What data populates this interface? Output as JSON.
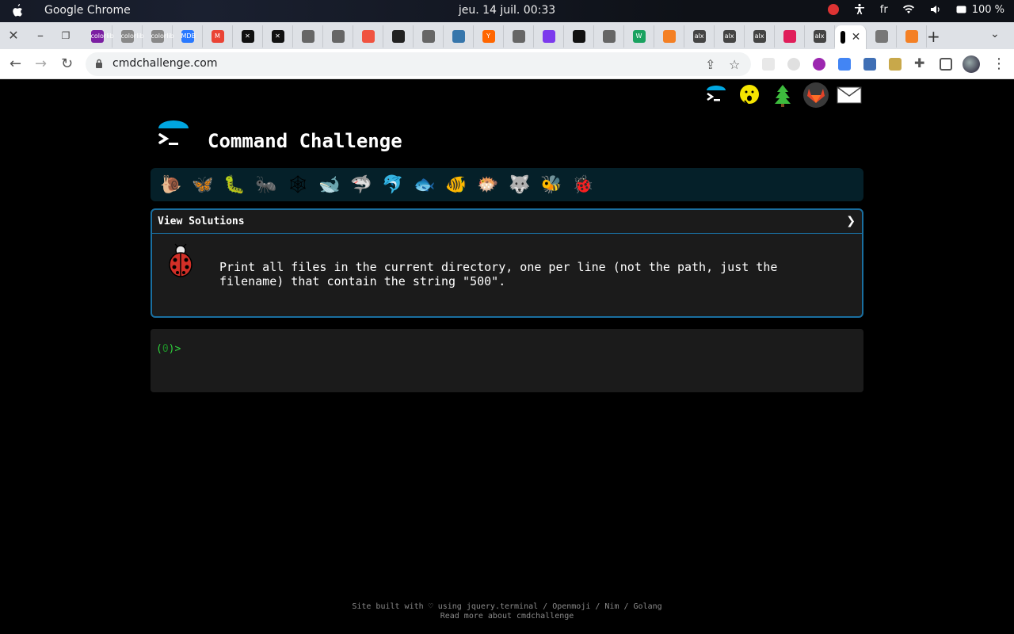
{
  "os": {
    "app_name": "Google Chrome",
    "clock": "jeu. 14 juil.  00:33",
    "lang": "fr",
    "battery": "100 %"
  },
  "browser": {
    "url": "cmdchallenge.com",
    "tabs": [
      {
        "icon": "colorlib-icon",
        "color": "#7b1fa2",
        "text": "colorlib"
      },
      {
        "icon": "colorlib-icon",
        "color": "#888888",
        "text": "colorlib"
      },
      {
        "icon": "colorlib-icon",
        "color": "#888888",
        "text": "colorlib"
      },
      {
        "icon": "mdb-icon",
        "color": "#2979ff",
        "text": "MDB"
      },
      {
        "icon": "gmail-icon",
        "color": "#ea4335",
        "text": "M"
      },
      {
        "icon": "x-circle-icon",
        "color": "#111111",
        "text": "✕"
      },
      {
        "icon": "x-circle-icon",
        "color": "#111111",
        "text": "✕"
      },
      {
        "icon": "globe-icon",
        "color": "#666666",
        "text": ""
      },
      {
        "icon": "globe-icon",
        "color": "#666666",
        "text": ""
      },
      {
        "icon": "laravel-icon",
        "color": "#f05340",
        "text": ""
      },
      {
        "icon": "badge-icon",
        "color": "#222222",
        "text": ""
      },
      {
        "icon": "globe-icon",
        "color": "#666666",
        "text": ""
      },
      {
        "icon": "python-icon",
        "color": "#3776ab",
        "text": ""
      },
      {
        "icon": "y-icon",
        "color": "#ff6600",
        "text": "Y"
      },
      {
        "icon": "globe-icon",
        "color": "#666666",
        "text": ""
      },
      {
        "icon": "purple-square-icon",
        "color": "#7c3aed",
        "text": ""
      },
      {
        "icon": "flag-icon",
        "color": "#111111",
        "text": ""
      },
      {
        "icon": "globe-icon",
        "color": "#666666",
        "text": ""
      },
      {
        "icon": "w-icon",
        "color": "#1aa260",
        "text": "W"
      },
      {
        "icon": "stackoverflow-icon",
        "color": "#f48024",
        "text": ""
      },
      {
        "icon": "alx-icon",
        "color": "#444444",
        "text": "alx"
      },
      {
        "icon": "alx-icon",
        "color": "#444444",
        "text": "alx"
      },
      {
        "icon": "alx-icon",
        "color": "#444444",
        "text": "alx"
      },
      {
        "icon": "slack-icon",
        "color": "#e01e5a",
        "text": ""
      },
      {
        "icon": "alx-icon",
        "color": "#444444",
        "text": "alx"
      }
    ]
  },
  "site": {
    "title": "Command Challenge",
    "view_solutions": "View Solutions",
    "chevron": "❯",
    "challenge_text": "Print all files in the current directory, one per line (not the path, just the filename) that contain the string \"500\".",
    "prompt_open": "(",
    "prompt_count": "0",
    "prompt_close": ")>",
    "footer_line1": "Site built with ♡ using jquery.terminal / Openmoji / Nim / Golang",
    "footer_line2": "Read more about cmdchallenge",
    "levels": [
      "🐌",
      "🦋",
      "🐛",
      "🐜",
      "🕸",
      "🐋",
      "🦈",
      "🐬",
      "🐟",
      "🐠",
      "🐡",
      "🐺",
      "🐝",
      "🐞"
    ],
    "top_icons": [
      "terminal-icon",
      "hushed-face-icon",
      "tree-icon",
      "gitlab-icon",
      "mail-icon"
    ]
  }
}
